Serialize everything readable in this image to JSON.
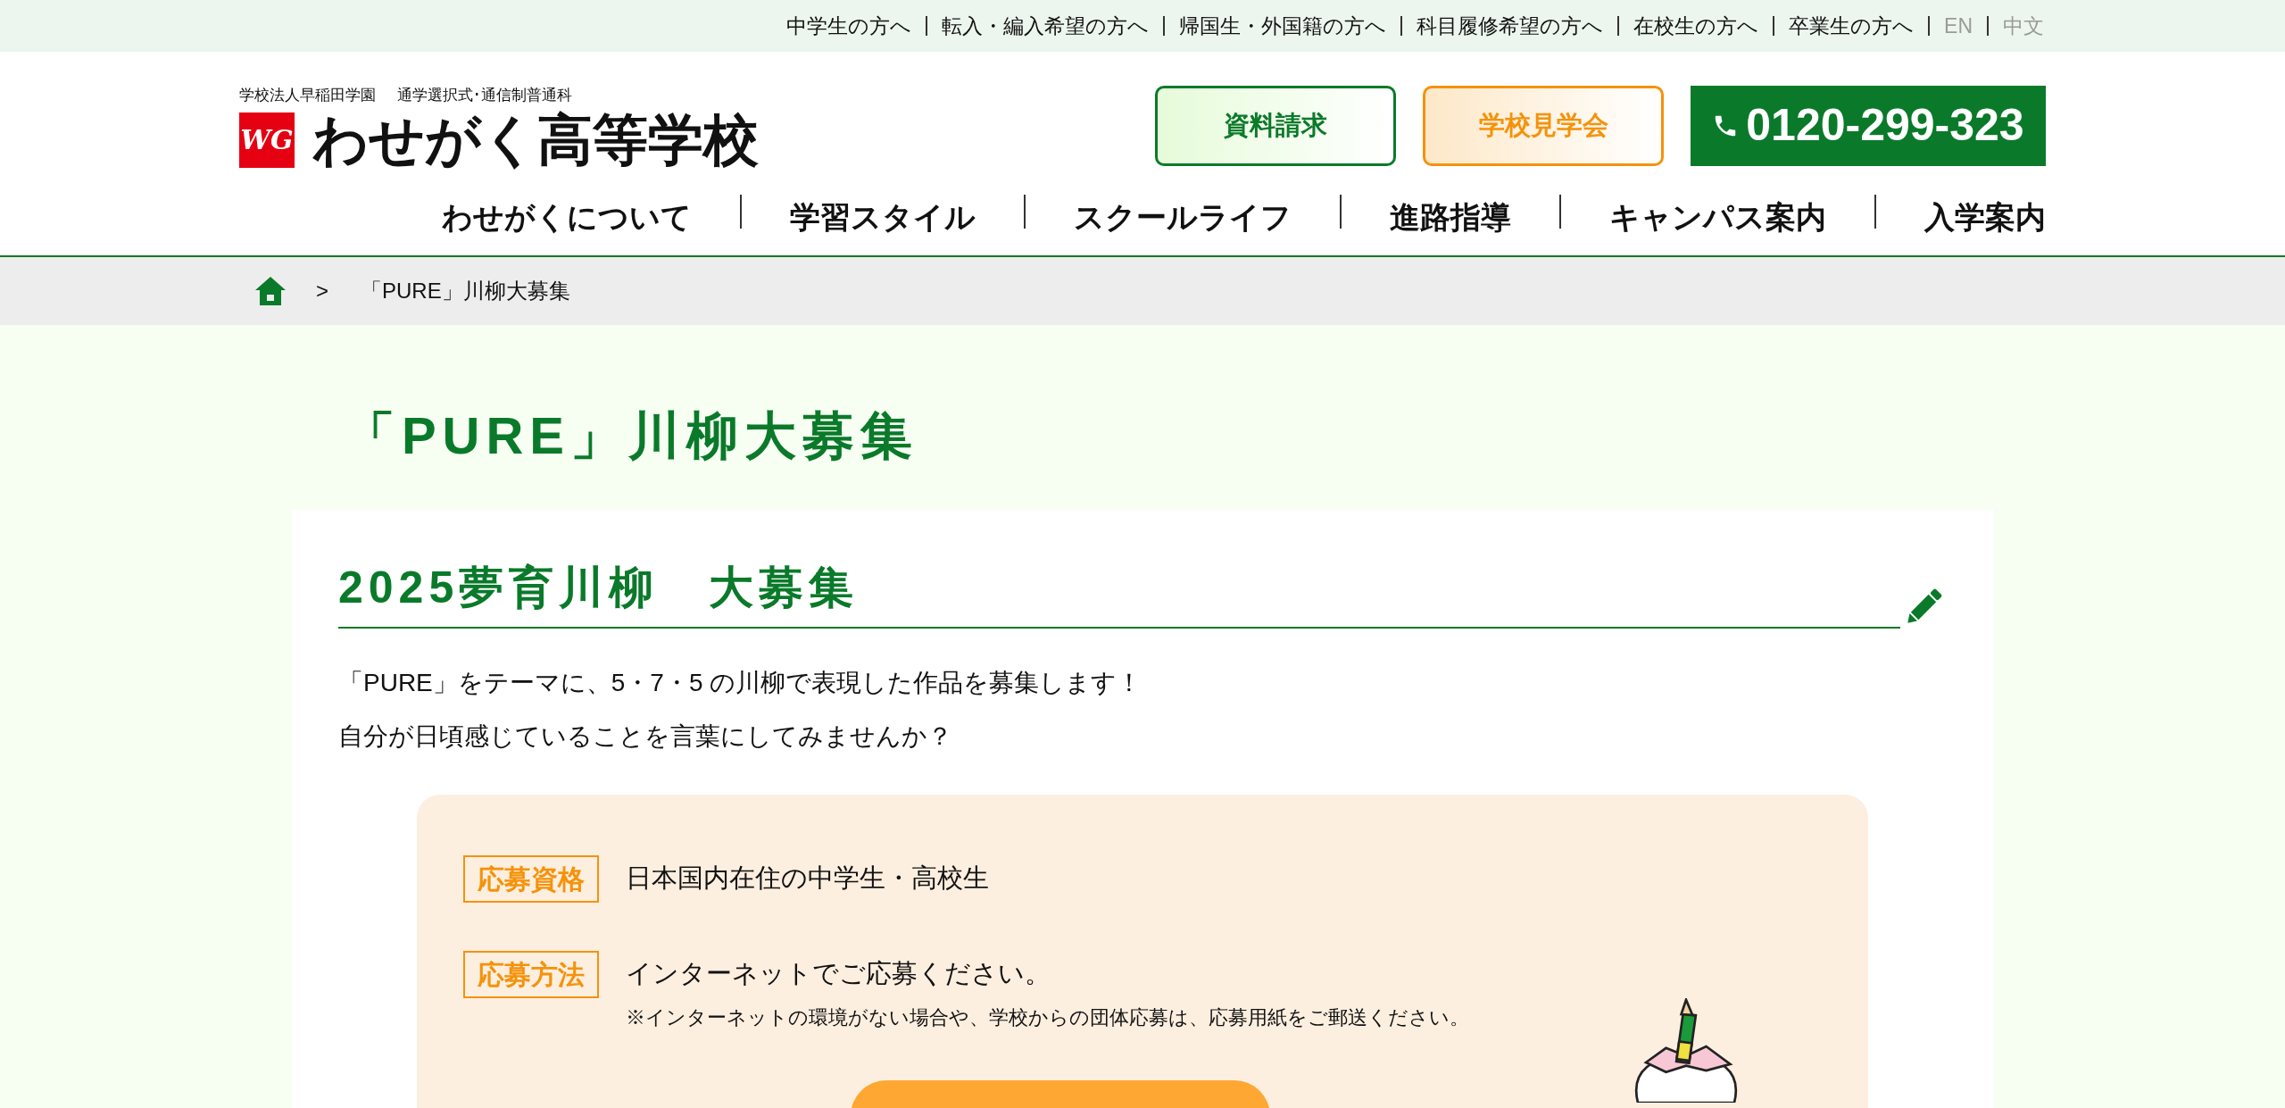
{
  "top_links": [
    {
      "label": "中学生の方へ",
      "kind": "jp"
    },
    {
      "label": "転入・編入希望の方へ",
      "kind": "jp"
    },
    {
      "label": "帰国生・外国籍の方へ",
      "kind": "jp"
    },
    {
      "label": "科目履修希望の方へ",
      "kind": "jp"
    },
    {
      "label": "在校生の方へ",
      "kind": "jp"
    },
    {
      "label": "卒業生の方へ",
      "kind": "jp"
    },
    {
      "label": "EN",
      "kind": "lang"
    },
    {
      "label": "中文",
      "kind": "lang"
    }
  ],
  "header": {
    "logo_mark": "WG",
    "org": "学校法人早稲田学園",
    "course": "通学選択式･通信制普通科",
    "school_name": "わせがく高等学校",
    "buttons": [
      {
        "label": "資料請求",
        "kind": "green"
      },
      {
        "label": "学校見学会",
        "kind": "orange"
      }
    ],
    "phone": "0120-299-323"
  },
  "nav": [
    "わせがくについて",
    "学習スタイル",
    "スクールライフ",
    "進路指導",
    "キャンパス案内",
    "入学案内"
  ],
  "breadcrumb": {
    "separator": ">",
    "current": "「PURE」川柳大募集"
  },
  "page_title": "「PURE」川柳大募集",
  "section": {
    "heading": "2025夢育川柳　大募集",
    "intro": [
      "「PURE」をテーマに、5・7・5 の川柳で表現した作品を募集します！",
      "自分が日頃感じていることを言葉にしてみませんか？"
    ],
    "details": [
      {
        "label": "応募資格",
        "text": "日本国内在住の中学生・高校生"
      },
      {
        "label": "応募方法",
        "text": "インターネットでご応募ください。",
        "note": "※インターネットの環境がない場合や、学校からの団体応募は、応募用紙をご郵送ください。"
      }
    ]
  }
}
